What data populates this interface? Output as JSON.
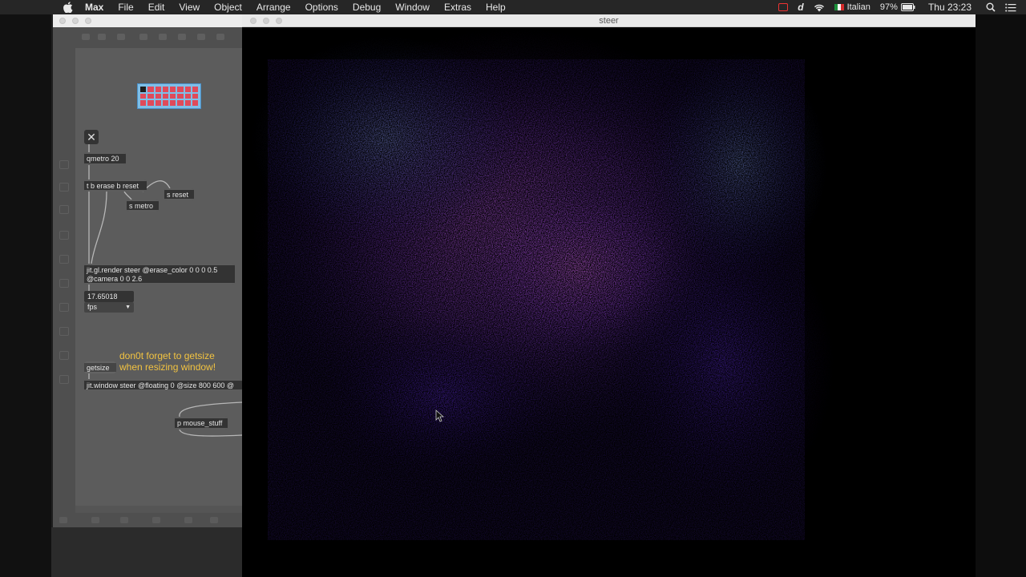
{
  "menubar": {
    "app_name": "Max",
    "items": [
      "File",
      "Edit",
      "View",
      "Object",
      "Arrange",
      "Options",
      "Debug",
      "Window",
      "Extras",
      "Help"
    ],
    "input_source": "Italian",
    "battery": "97%",
    "clock": "Thu 23:23"
  },
  "patcher": {
    "objects": {
      "qmetro": "qmetro 20",
      "trigger": "t b erase b reset",
      "send_reset": "s reset",
      "send_metro": "s metro",
      "render_line1": "jit.gl.render steer @erase_color 0 0 0 0.5",
      "render_line2": "@camera 0 0 2.6",
      "fps_value": "17.65018",
      "fps_menu": "fps",
      "comment_line1": "don0t forget to getsize",
      "comment_line2": "when resizing window!",
      "getsize": "getsize",
      "window_obj": "jit.window steer @floating 0 @size 800 600 @",
      "mouse_stuff": "p mouse_stuff"
    }
  },
  "render_window": {
    "title": "steer"
  },
  "colors": {
    "menubar_bg": "#262626",
    "patch_bg": "#5c5c5c",
    "comment": "#f2c341",
    "particle_accent": "#b050f0"
  }
}
